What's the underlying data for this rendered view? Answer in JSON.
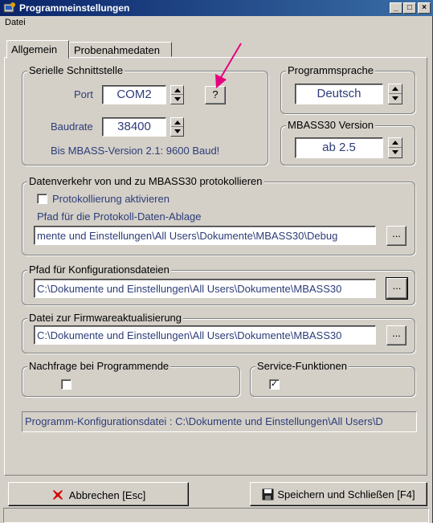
{
  "window": {
    "title": "Programmeinstellungen"
  },
  "title_buttons": {
    "minimize": "_",
    "maximize": "□",
    "close": "×"
  },
  "menu": {
    "items": [
      "Datei"
    ]
  },
  "tabs": [
    {
      "label": "Allgemein",
      "active": true
    },
    {
      "label": "Probenahmedaten",
      "active": false
    }
  ],
  "serial": {
    "title": "Serielle Schnittstelle",
    "port_label": "Port",
    "port_value": "COM2",
    "help_button": "?",
    "baud_label": "Baudrate",
    "baud_value": "38400",
    "note": "Bis MBASS-Version 2.1: 9600 Baud!"
  },
  "language": {
    "title": "Programmsprache",
    "value": "Deutsch"
  },
  "version": {
    "title": "MBASS30 Version",
    "value": "ab 2.5"
  },
  "logging": {
    "title": "Datenverkehr von und zu MBASS30 protokollieren",
    "checkbox_label": "Protokollierung aktivieren",
    "checked": false,
    "path_label": "Pfad für die Protokoll-Daten-Ablage",
    "path_value": "mente und Einstellungen\\All Users\\Dokumente\\MBASS30\\Debug",
    "browse_label": "..."
  },
  "config_path": {
    "title": "Pfad für Konfigurationsdateien",
    "value": "C:\\Dokumente und Einstellungen\\All Users\\Dokumente\\MBASS30",
    "browse_label": "..."
  },
  "firmware": {
    "title": "Datei zur Firmwareaktualisierung",
    "value": "C:\\Dokumente und Einstellungen\\All Users\\Dokumente\\MBASS30",
    "browse_label": "..."
  },
  "exit_prompt": {
    "title": "Nachfrage bei Programmende",
    "checked": false
  },
  "service": {
    "title": "Service-Funktionen",
    "checked": true,
    "check_mark": "✓"
  },
  "config_file_status": "Programm-Konfigurationsdatei : C:\\Dokumente und Einstellungen\\All Users\\D",
  "buttons": {
    "cancel": "Abbrechen [Esc]",
    "save": "Speichern und Schließen [F4]"
  },
  "colors": {
    "titlebar": "#0a246a",
    "face": "#d4d0c8",
    "text_blue": "#2d3c78",
    "arrow": "#e6007e",
    "cancel_icon": "#d40000"
  }
}
